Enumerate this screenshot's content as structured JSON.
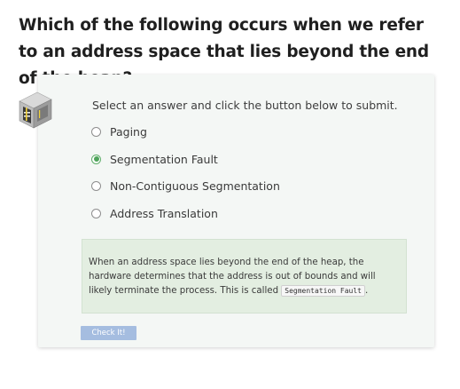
{
  "question": {
    "title": "Which of the following occurs when we refer to an address space that lies beyond the end of the heap?"
  },
  "quiz": {
    "icon": "quiz-server-icon",
    "instructions": "Select an answer and click the button below to submit.",
    "options": [
      {
        "label": "Paging",
        "selected": false
      },
      {
        "label": "Segmentation Fault",
        "selected": true
      },
      {
        "label": "Non-Contiguous Segmentation",
        "selected": false
      },
      {
        "label": "Address Translation",
        "selected": false
      }
    ],
    "feedback": {
      "text_before": "When an address space lies beyond the end of the heap, the hardware determines that the address is out of bounds and will likely terminate the process. This is called ",
      "code": "Segmentation Fault",
      "text_after": "."
    },
    "submit_label": "Check It!"
  },
  "colors": {
    "card_background": "#f4f7f5",
    "feedback_background": "#e3eee1",
    "selected_radio": "#4fa35b",
    "button_background": "#a5bde0"
  }
}
